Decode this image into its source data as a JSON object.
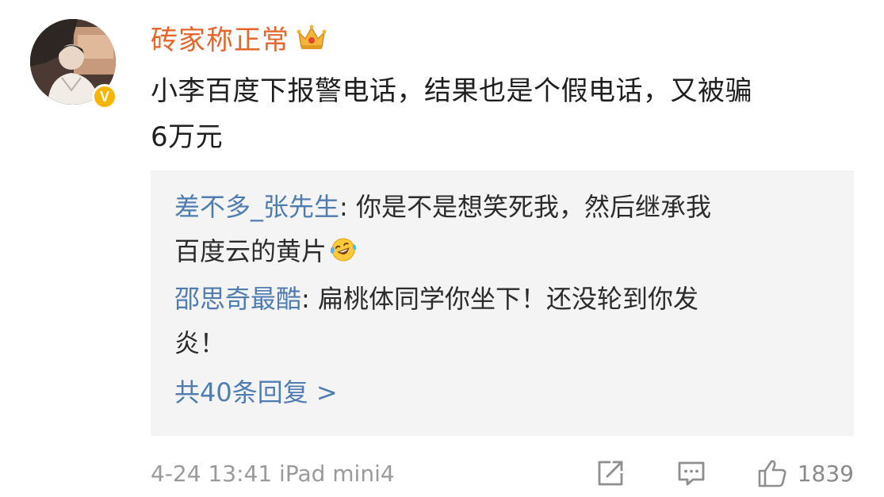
{
  "post": {
    "username": "砖家称正常",
    "username_color": "#e5652b",
    "badge_icon": "crown-icon",
    "verified_badge": "v-icon",
    "verified_letter": "V",
    "content_line1": "小李百度下报警电话，结果也是个假电话，又被骗",
    "content_line2": "6万元"
  },
  "replies": [
    {
      "user": "差不多_张先生",
      "separator": ": ",
      "text_line1": "你是不是想笑死我，然后继承我",
      "text_line2": "百度云的黄片",
      "emoji": "laugh-cry-emoji"
    },
    {
      "user": "邵思奇最酷",
      "separator": ": ",
      "text_line1": "扁桃体同学你坐下！还没轮到你发",
      "text_line2": "炎！"
    }
  ],
  "more_replies": "共40条回复 >",
  "link_color": "#507daf",
  "footer": {
    "meta": "4-24 13:41  iPad mini4",
    "share_icon": "share-icon",
    "comment_icon": "comment-icon",
    "like_icon": "thumbs-up-icon",
    "like_count": "1839"
  }
}
